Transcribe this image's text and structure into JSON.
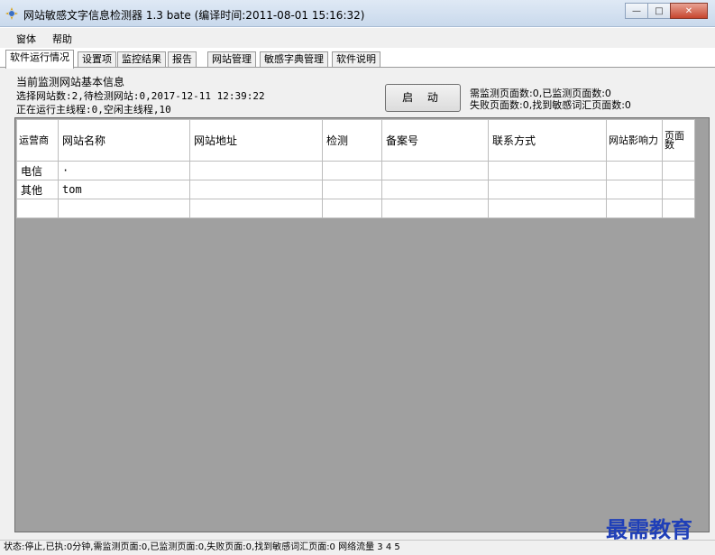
{
  "window": {
    "title": "网站敏感文字信息检测器 1.3 bate (编译时间:2011-08-01 15:16:32)",
    "icon": "app-icon",
    "controls": {
      "minimize": "—",
      "maximize": "□",
      "close": "✕"
    }
  },
  "menu": {
    "items": [
      "窗体",
      "帮助"
    ]
  },
  "tabs": [
    "软件运行情况",
    "设置项",
    "监控结果",
    "报告",
    "网站管理",
    "敏感字典管理",
    "软件说明"
  ],
  "info": {
    "title": "当前监测网站基本信息",
    "line1": "选择网站数:2,待检测网站:0,2017-12-11 12:39:22",
    "line2": "正在运行主线程:0,空闲主线程,10"
  },
  "start_button": "启 动",
  "stats": {
    "line1": "需监测页面数:0,已监测页面数:0",
    "line2": "失败页面数:0,找到敏感词汇页面数:0"
  },
  "table": {
    "columns": [
      "运营商",
      "网站名称",
      "网站地址",
      "检测",
      "备案号",
      "联系方式",
      "网站影响力",
      "页面数"
    ],
    "rows": [
      [
        "电信",
        "·",
        "",
        "",
        "",
        "",
        "",
        ""
      ],
      [
        "其他",
        "tom",
        "",
        "",
        "",
        "",
        "",
        ""
      ],
      [
        "",
        "",
        "",
        "",
        "",
        "",
        "",
        ""
      ]
    ]
  },
  "statusbar": {
    "text": "状态:停止,已执:0分钟,需监测页面:0,已监测页面:0,失败页面:0,找到敏感词汇页面:0   网络流量  3  4  5"
  },
  "watermark": "最需教育",
  "colors": {
    "grid_background": "#a0a0a0",
    "watermark": "#1f3fb8"
  }
}
